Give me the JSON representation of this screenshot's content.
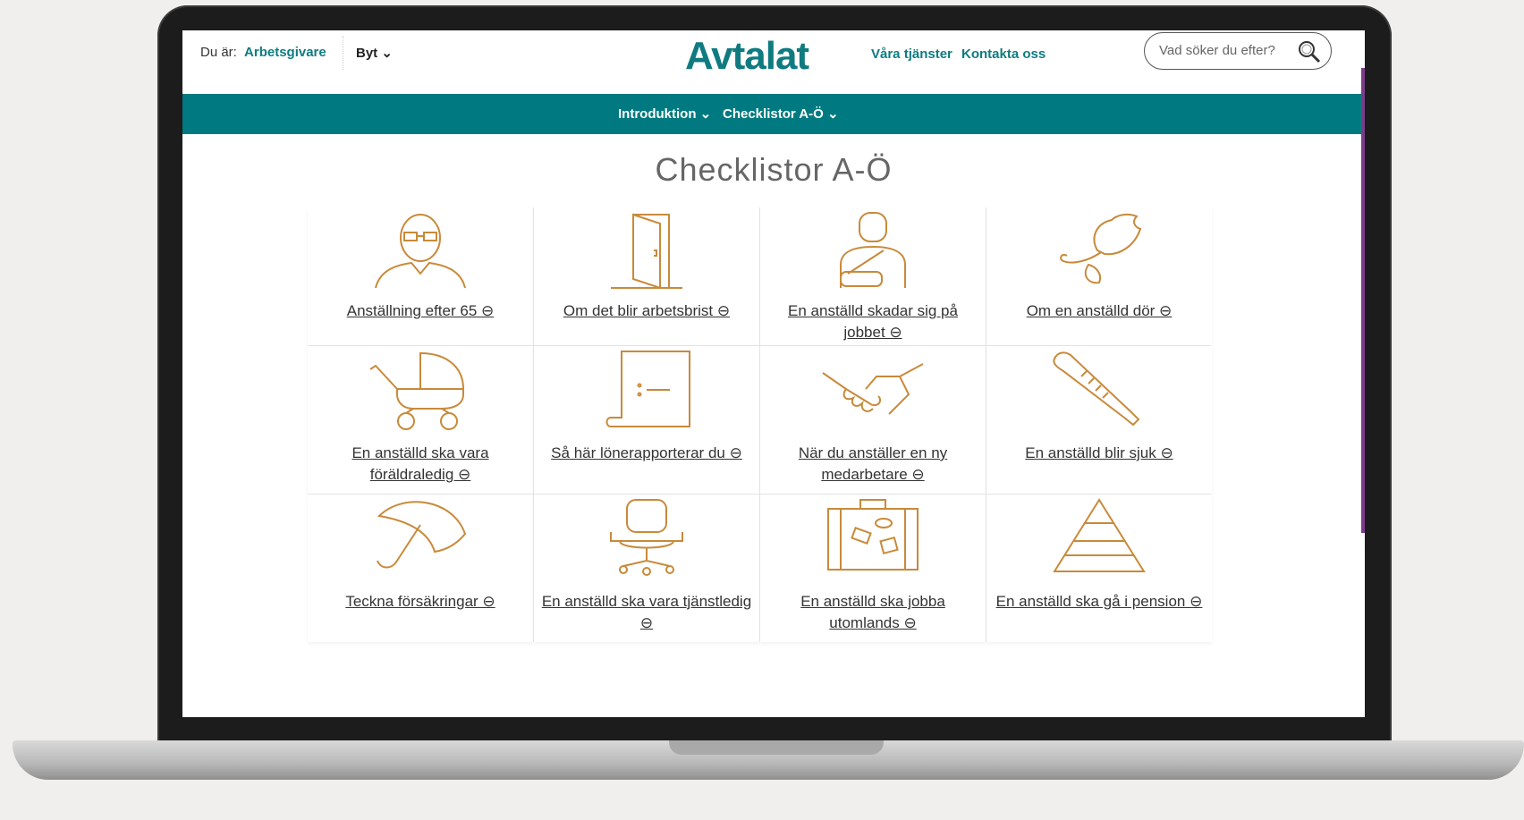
{
  "header": {
    "context_prefix": "Du är:",
    "context_role": "Arbetsgivare",
    "switch_label": "Byt ⌄",
    "logo": "Avtalat",
    "links": [
      "Våra tjänster",
      "Kontakta oss"
    ],
    "search_placeholder": "Vad söker du efter?"
  },
  "nav": [
    "Introduktion ⌄",
    "Checklistor A-Ö ⌄"
  ],
  "page_title": "Checklistor A-Ö",
  "cards": [
    {
      "label": "Anställning efter 65 ⊖",
      "icon": "man-with-glasses-icon"
    },
    {
      "label": "Om det blir arbetsbrist ⊖",
      "icon": "open-door-icon"
    },
    {
      "label": "En anställd skadar sig på jobbet ⊖",
      "icon": "injured-person-icon"
    },
    {
      "label": "Om en anställd dör ⊖",
      "icon": "rose-icon"
    },
    {
      "label": "En anställd ska vara föräldraledig ⊖",
      "icon": "baby-carriage-icon"
    },
    {
      "label": "Så här lönerapporterar du ⊖",
      "icon": "document-scroll-icon"
    },
    {
      "label": "När du anställer en ny medarbetare ⊖",
      "icon": "handshake-icon"
    },
    {
      "label": "En anställd blir sjuk ⊖",
      "icon": "thermometer-icon"
    },
    {
      "label": "Teckna försäkringar ⊖",
      "icon": "umbrella-icon"
    },
    {
      "label": "En anställd ska vara tjänstledig ⊖",
      "icon": "office-chair-icon"
    },
    {
      "label": "En anställd ska jobba utomlands ⊖",
      "icon": "suitcase-icon"
    },
    {
      "label": "En anställd ska gå i pension ⊖",
      "icon": "pyramid-icon"
    }
  ],
  "colors": {
    "brand": "#007a80",
    "icon": "#c88a3a"
  }
}
